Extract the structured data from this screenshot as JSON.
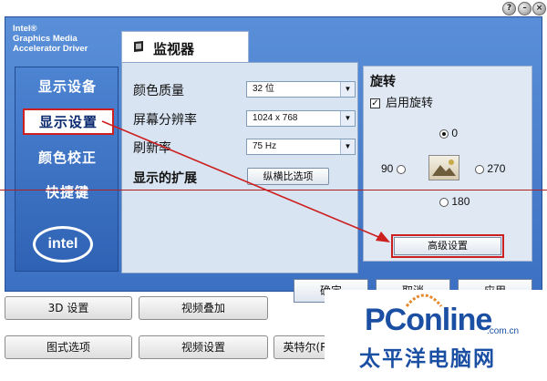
{
  "brand": {
    "line1": "Intel®",
    "line2": "Graphics Media",
    "line3": "Accelerator Driver"
  },
  "sidebar": {
    "items": [
      {
        "label": "显示设备"
      },
      {
        "label": "显示设置",
        "active": true
      },
      {
        "label": "颜色校正"
      },
      {
        "label": "快捷键"
      }
    ],
    "logo_text": "intel"
  },
  "tab": {
    "title": "监视器",
    "icon": "monitor-icon"
  },
  "settings": {
    "color_quality": {
      "label": "颜色质量",
      "value": "32 位"
    },
    "resolution": {
      "label": "屏幕分辨率",
      "value": "1024 x 768"
    },
    "refresh_rate": {
      "label": "刷新率",
      "value": "75 Hz"
    },
    "extension_label": "显示的扩展",
    "aspect_button": "纵横比选项"
  },
  "rotation": {
    "title": "旋转",
    "enable_label": "启用旋转",
    "enabled": true,
    "options": {
      "r0": "0",
      "r90": "90",
      "r180": "180",
      "r270": "270"
    },
    "selected": "0"
  },
  "advanced_button": "高级设置",
  "dialog_buttons": {
    "ok": "确定",
    "cancel": "取消",
    "apply": "应用"
  },
  "lower_buttons": {
    "settings_3d": "3D 设置",
    "video_overlay": "视频叠加",
    "schemes": "图式选项",
    "video_settings": "视频设置",
    "intel_r": "英特尔(R"
  },
  "watermark": {
    "main": "PConline",
    "sub": ".com.cn",
    "cn": "太平洋电脑网"
  },
  "colors": {
    "frame_blue": "#3c70c2",
    "annotation_red": "#cc1f1f",
    "watermark_blue": "#1b4fa3"
  }
}
